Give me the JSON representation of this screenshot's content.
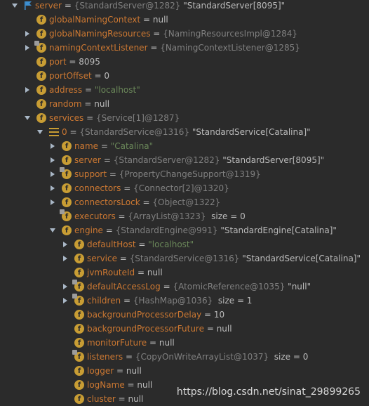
{
  "rows": [
    {
      "name": "server",
      "value": "{StandardServer@1282}",
      "extra": "\"StandardServer[8095]\"",
      "icon": "flag-icon"
    },
    {
      "name": "globalNamingContext",
      "value": "null",
      "icon": "field-icon"
    },
    {
      "name": "globalNamingResources",
      "value": "{NamingResourcesImpl@1284}",
      "icon": "field-icon"
    },
    {
      "name": "namingContextListener",
      "value": "{NamingContextListener@1285}",
      "icon": "field-icon"
    },
    {
      "name": "port",
      "value": "8095",
      "icon": "field-icon"
    },
    {
      "name": "portOffset",
      "value": "0",
      "icon": "field-icon"
    },
    {
      "name": "address",
      "value": "\"localhost\"",
      "icon": "field-icon"
    },
    {
      "name": "random",
      "value": "null",
      "icon": "field-icon"
    },
    {
      "name": "services",
      "value": "{Service[1]@1287}",
      "icon": "field-icon"
    },
    {
      "name": "0",
      "value": "{StandardService@1316}",
      "extra": "\"StandardService[Catalina]\"",
      "icon": "list-icon"
    },
    {
      "name": "name",
      "value": "\"Catalina\"",
      "icon": "field-icon"
    },
    {
      "name": "server",
      "value": "{StandardServer@1282}",
      "extra": "\"StandardServer[8095]\"",
      "icon": "field-icon"
    },
    {
      "name": "support",
      "value": "{PropertyChangeSupport@1319}",
      "icon": "field-icon"
    },
    {
      "name": "connectors",
      "value": "{Connector[2]@1320}",
      "icon": "field-icon"
    },
    {
      "name": "connectorsLock",
      "value": "{Object@1322}",
      "icon": "field-icon"
    },
    {
      "name": "executors",
      "value": "{ArrayList@1323}",
      "extra": "size = 0",
      "icon": "field-icon"
    },
    {
      "name": "engine",
      "value": "{StandardEngine@991}",
      "extra": "\"StandardEngine[Catalina]\"",
      "icon": "field-icon"
    },
    {
      "name": "defaultHost",
      "value": "\"localhost\"",
      "icon": "field-icon"
    },
    {
      "name": "service",
      "value": "{StandardService@1316}",
      "extra": "\"StandardService[Catalina]\"",
      "icon": "field-icon"
    },
    {
      "name": "jvmRouteId",
      "value": "null",
      "icon": "field-icon"
    },
    {
      "name": "defaultAccessLog",
      "value": "{AtomicReference@1035}",
      "extra": "\"null\"",
      "icon": "field-icon"
    },
    {
      "name": "children",
      "value": "{HashMap@1036}",
      "extra": "size = 1",
      "icon": "field-icon"
    },
    {
      "name": "backgroundProcessorDelay",
      "value": "10",
      "icon": "field-icon"
    },
    {
      "name": "backgroundProcessorFuture",
      "value": "null",
      "icon": "field-icon"
    },
    {
      "name": "monitorFuture",
      "value": "null",
      "icon": "field-icon"
    },
    {
      "name": "listeners",
      "value": "{CopyOnWriteArrayList@1037}",
      "extra": "size = 0",
      "icon": "field-icon"
    },
    {
      "name": "logger",
      "value": "null",
      "icon": "field-icon"
    },
    {
      "name": "logName",
      "value": "null",
      "icon": "field-icon"
    },
    {
      "name": "cluster",
      "value": "null",
      "icon": "field-icon"
    }
  ],
  "field_icon_letter": "f",
  "watermark": "https://blog.csdn.net/sinat_29899265"
}
